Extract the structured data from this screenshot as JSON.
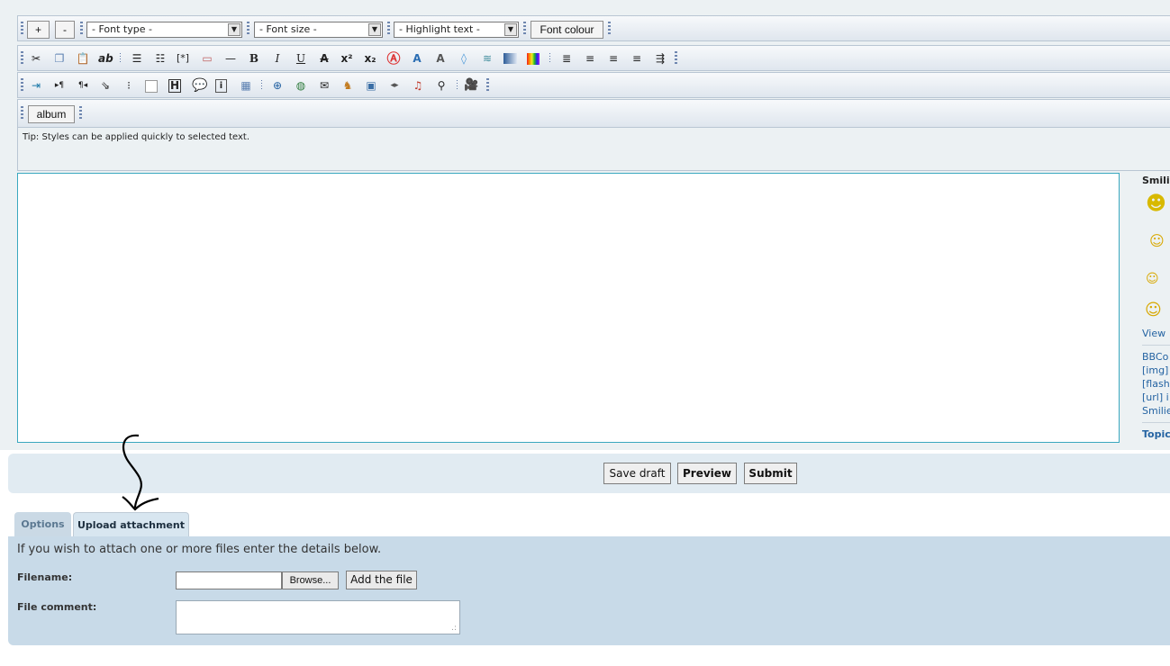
{
  "toolbar1": {
    "increase_label": "+",
    "decrease_label": "-",
    "font_type": "- Font type -",
    "font_size": "- Font size -",
    "highlight": "- Highlight text -",
    "font_colour": "Font colour"
  },
  "toolbar4": {
    "album_label": "album"
  },
  "tip": "Tip: Styles can be applied quickly to selected text.",
  "sidebar": {
    "title": "Smili",
    "view_more": "View",
    "bbcode": "BBCo",
    "img": "[img]",
    "flash": "[flash",
    "url": "[url] i",
    "smilies": "Smilie",
    "topic": "Topic"
  },
  "submit_bar": {
    "save_draft": "Save draft",
    "preview": "Preview",
    "submit": "Submit"
  },
  "tabs": {
    "options": "Options",
    "upload": "Upload attachment"
  },
  "attachment": {
    "intro": "If you wish to attach one or more files enter the details below.",
    "filename_label": "Filename:",
    "browse": "Browse...",
    "add_file": "Add the file",
    "comment_label": "File comment:"
  }
}
